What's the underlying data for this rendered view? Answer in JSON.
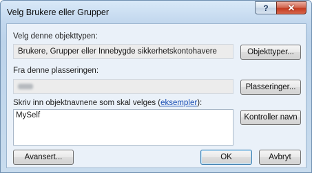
{
  "window": {
    "title": "Velg Brukere eller Grupper",
    "help_label": "?",
    "close_label": "✕"
  },
  "object_type": {
    "label": "Velg denne objekttypen:",
    "value": "Brukere, Grupper eller Innebygde sikkerhetskontohavere",
    "button_label": "Objekttyper..."
  },
  "location": {
    "label": "Fra denne plasseringen:",
    "button_label": "Plasseringer..."
  },
  "object_names": {
    "label_prefix": "Skriv inn objektnavnene som skal velges (",
    "link_label": "eksempler",
    "label_suffix": "):",
    "value": "MySelf",
    "check_button_label": "Kontroller navn"
  },
  "footer": {
    "advanced_label": "Avansert...",
    "ok_label": "OK",
    "cancel_label": "Avbryt"
  }
}
